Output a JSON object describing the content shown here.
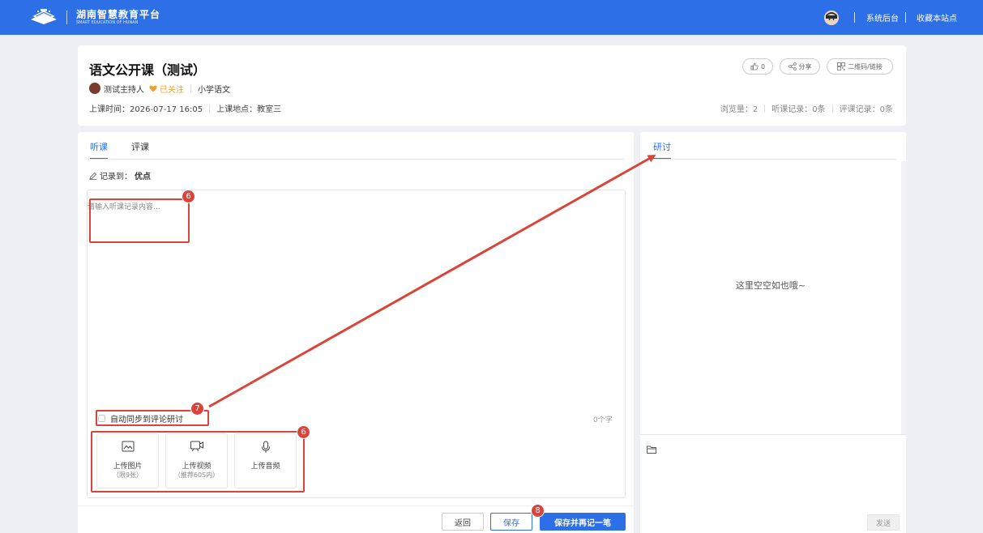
{
  "topbar": {
    "brand_name": "湖南智慧教育平台",
    "brand_sub": "SMART EDUCATION OF HUNAN",
    "links": [
      "系统后台",
      "收藏本站点"
    ]
  },
  "course": {
    "title": "语文公开课（测试）",
    "host": "测试主持人",
    "follow": "已关注",
    "subject": "小学语文",
    "time": "上课时间：2026-07-17 16:05",
    "location": "上课地点：教室三",
    "stats": [
      "浏览量：2",
      "听课记录：0条",
      "评课记录：0条"
    ],
    "actions": {
      "like": "0",
      "share": "分享",
      "qrcode": "二维码/链接"
    }
  },
  "left": {
    "tabs": [
      "听课",
      "评课"
    ],
    "record_to_label": "记录到：",
    "record_to_value": "优点",
    "placeholder": "请输入听课记录内容...",
    "sync_label": "自动同步到评论研讨",
    "char_count": "0个字",
    "uploads": [
      {
        "label": "上传图片",
        "hint": "（限9张）"
      },
      {
        "label": "上传视频",
        "hint": "（推荐60S内）"
      },
      {
        "label": "上传音频",
        "hint": ""
      }
    ],
    "buttons": {
      "back": "返回",
      "save": "保存",
      "save_again": "保存并再记一笔"
    }
  },
  "right": {
    "tab": "研讨",
    "empty": "这里空空如也哦~",
    "send": "发送"
  },
  "annotations": [
    "6",
    "7",
    "6",
    "8"
  ],
  "colors": {
    "brand": "#2c6fe7",
    "annotation": "#d9453a",
    "follow": "#f0a030"
  }
}
